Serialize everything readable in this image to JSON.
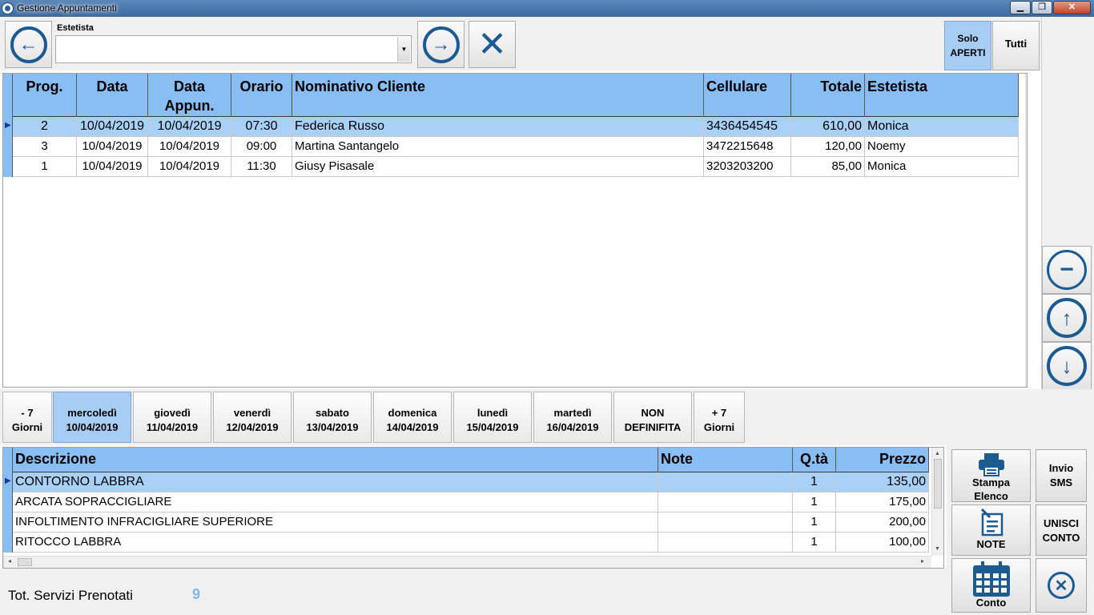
{
  "window": {
    "title": "Gestione Appuntamenti",
    "min": "▁",
    "max": "❐",
    "close": "✕"
  },
  "toolbar": {
    "estetista_label": "Estetista",
    "estetista_value": "",
    "solo_aperti": "Solo APERTI",
    "tutti": "Tutti"
  },
  "appointments": {
    "columns": [
      "Prog.",
      "Data",
      "Data Appun.",
      "Orario",
      "Nominativo Cliente",
      "Cellulare",
      "Totale",
      "Estetista"
    ],
    "rows": [
      {
        "prog": "2",
        "data": "10/04/2019",
        "data_app": "10/04/2019",
        "orario": "07:30",
        "nome": "Federica Russo",
        "cell": "3436454545",
        "totale": "610,00",
        "estetista": "Monica"
      },
      {
        "prog": "3",
        "data": "10/04/2019",
        "data_app": "10/04/2019",
        "orario": "09:00",
        "nome": "Martina Santangelo",
        "cell": "3472215648",
        "totale": "120,00",
        "estetista": "Noemy"
      },
      {
        "prog": "1",
        "data": "10/04/2019",
        "data_app": "10/04/2019",
        "orario": "11:30",
        "nome": "Giusy Pisasale",
        "cell": "3203203200",
        "totale": "85,00",
        "estetista": "Monica"
      }
    ]
  },
  "days": [
    {
      "l1": "- 7",
      "l2": "Giorni"
    },
    {
      "l1": "mercoledì",
      "l2": "10/04/2019"
    },
    {
      "l1": "giovedì",
      "l2": "11/04/2019"
    },
    {
      "l1": "venerdì",
      "l2": "12/04/2019"
    },
    {
      "l1": "sabato",
      "l2": "13/04/2019"
    },
    {
      "l1": "domenica",
      "l2": "14/04/2019"
    },
    {
      "l1": "lunedì",
      "l2": "15/04/2019"
    },
    {
      "l1": "martedì",
      "l2": "16/04/2019"
    },
    {
      "l1": "NON",
      "l2": "DEFINIFITA"
    },
    {
      "l1": "+ 7",
      "l2": "Giorni"
    }
  ],
  "services": {
    "columns": [
      "Descrizione",
      "Note",
      "Q.tà",
      "Prezzo"
    ],
    "rows": [
      {
        "desc": "CONTORNO LABBRA",
        "note": "",
        "qta": "1",
        "prezzo": "135,00"
      },
      {
        "desc": "ARCATA SOPRACCIGLIARE",
        "note": "",
        "qta": "1",
        "prezzo": "175,00"
      },
      {
        "desc": "INFOLTIMENTO INFRACIGLIARE SUPERIORE",
        "note": "",
        "qta": "1",
        "prezzo": "200,00"
      },
      {
        "desc": "RITOCCO LABBRA",
        "note": "",
        "qta": "1",
        "prezzo": "100,00"
      }
    ]
  },
  "footer": {
    "tot_label": "Tot. Servizi Prenotati",
    "tot_value": "9"
  },
  "actions": {
    "stampa_l1": "Stampa",
    "stampa_l2": "Elenco",
    "sms_l1": "Invio",
    "sms_l2": "SMS",
    "note": "NOTE",
    "unisci_l1": "UNISCI",
    "unisci_l2": "CONTO",
    "conto": "Conto"
  },
  "colors": {
    "header": "#89bef5",
    "selected": "#a9d1f8",
    "accent": "#1c5a92"
  }
}
